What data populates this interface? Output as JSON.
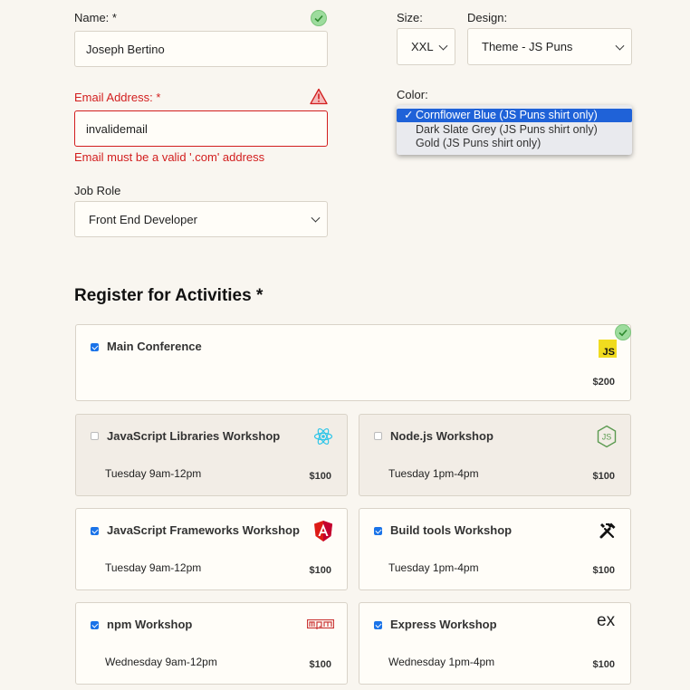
{
  "form": {
    "name": {
      "label": "Name:",
      "required_mark": "*",
      "value": "Joseph Bertino",
      "status": "valid"
    },
    "email": {
      "label": "Email Address:",
      "required_mark": "*",
      "value": "invalidemail",
      "error": "Email must be a valid '.com' address",
      "status": "error"
    },
    "job_role": {
      "label": "Job Role",
      "value": "Front End Developer"
    }
  },
  "shirt": {
    "size": {
      "label": "Size:",
      "value": "XXL"
    },
    "design": {
      "label": "Design:",
      "value": "Theme - JS Puns"
    },
    "color": {
      "label": "Color:",
      "options": [
        {
          "label": "Cornflower Blue (JS Puns shirt only)",
          "selected": true
        },
        {
          "label": "Dark Slate Grey (JS Puns shirt only)",
          "selected": false
        },
        {
          "label": "Gold (JS Puns shirt only)",
          "selected": false
        }
      ],
      "check_glyph": "✓"
    }
  },
  "activities": {
    "heading": "Register for Activities",
    "required_mark": "*",
    "items": [
      {
        "title": "Main Conference",
        "time": "",
        "cost": "$200",
        "checked": true,
        "icon": "js-icon"
      },
      {
        "title": "JavaScript Libraries Workshop",
        "time": "Tuesday 9am-12pm",
        "cost": "$100",
        "checked": false,
        "icon": "react-icon"
      },
      {
        "title": "Node.js Workshop",
        "time": "Tuesday 1pm-4pm",
        "cost": "$100",
        "checked": false,
        "icon": "nodejs-icon"
      },
      {
        "title": "JavaScript Frameworks Workshop",
        "time": "Tuesday 9am-12pm",
        "cost": "$100",
        "checked": true,
        "icon": "angular-icon"
      },
      {
        "title": "Build tools Workshop",
        "time": "Tuesday 1pm-4pm",
        "cost": "$100",
        "checked": true,
        "icon": "tools-icon"
      },
      {
        "title": "npm Workshop",
        "time": "Wednesday 9am-12pm",
        "cost": "$100",
        "checked": true,
        "icon": "npm-icon"
      },
      {
        "title": "Express Workshop",
        "time": "Wednesday 1pm-4pm",
        "cost": "$100",
        "checked": true,
        "icon": "express-icon"
      }
    ],
    "icon_text": {
      "js": "JS",
      "express": "ex"
    }
  },
  "colors": {
    "error": "#d21e1e",
    "valid": "#8fd18f",
    "accent": "#1f62d8"
  }
}
